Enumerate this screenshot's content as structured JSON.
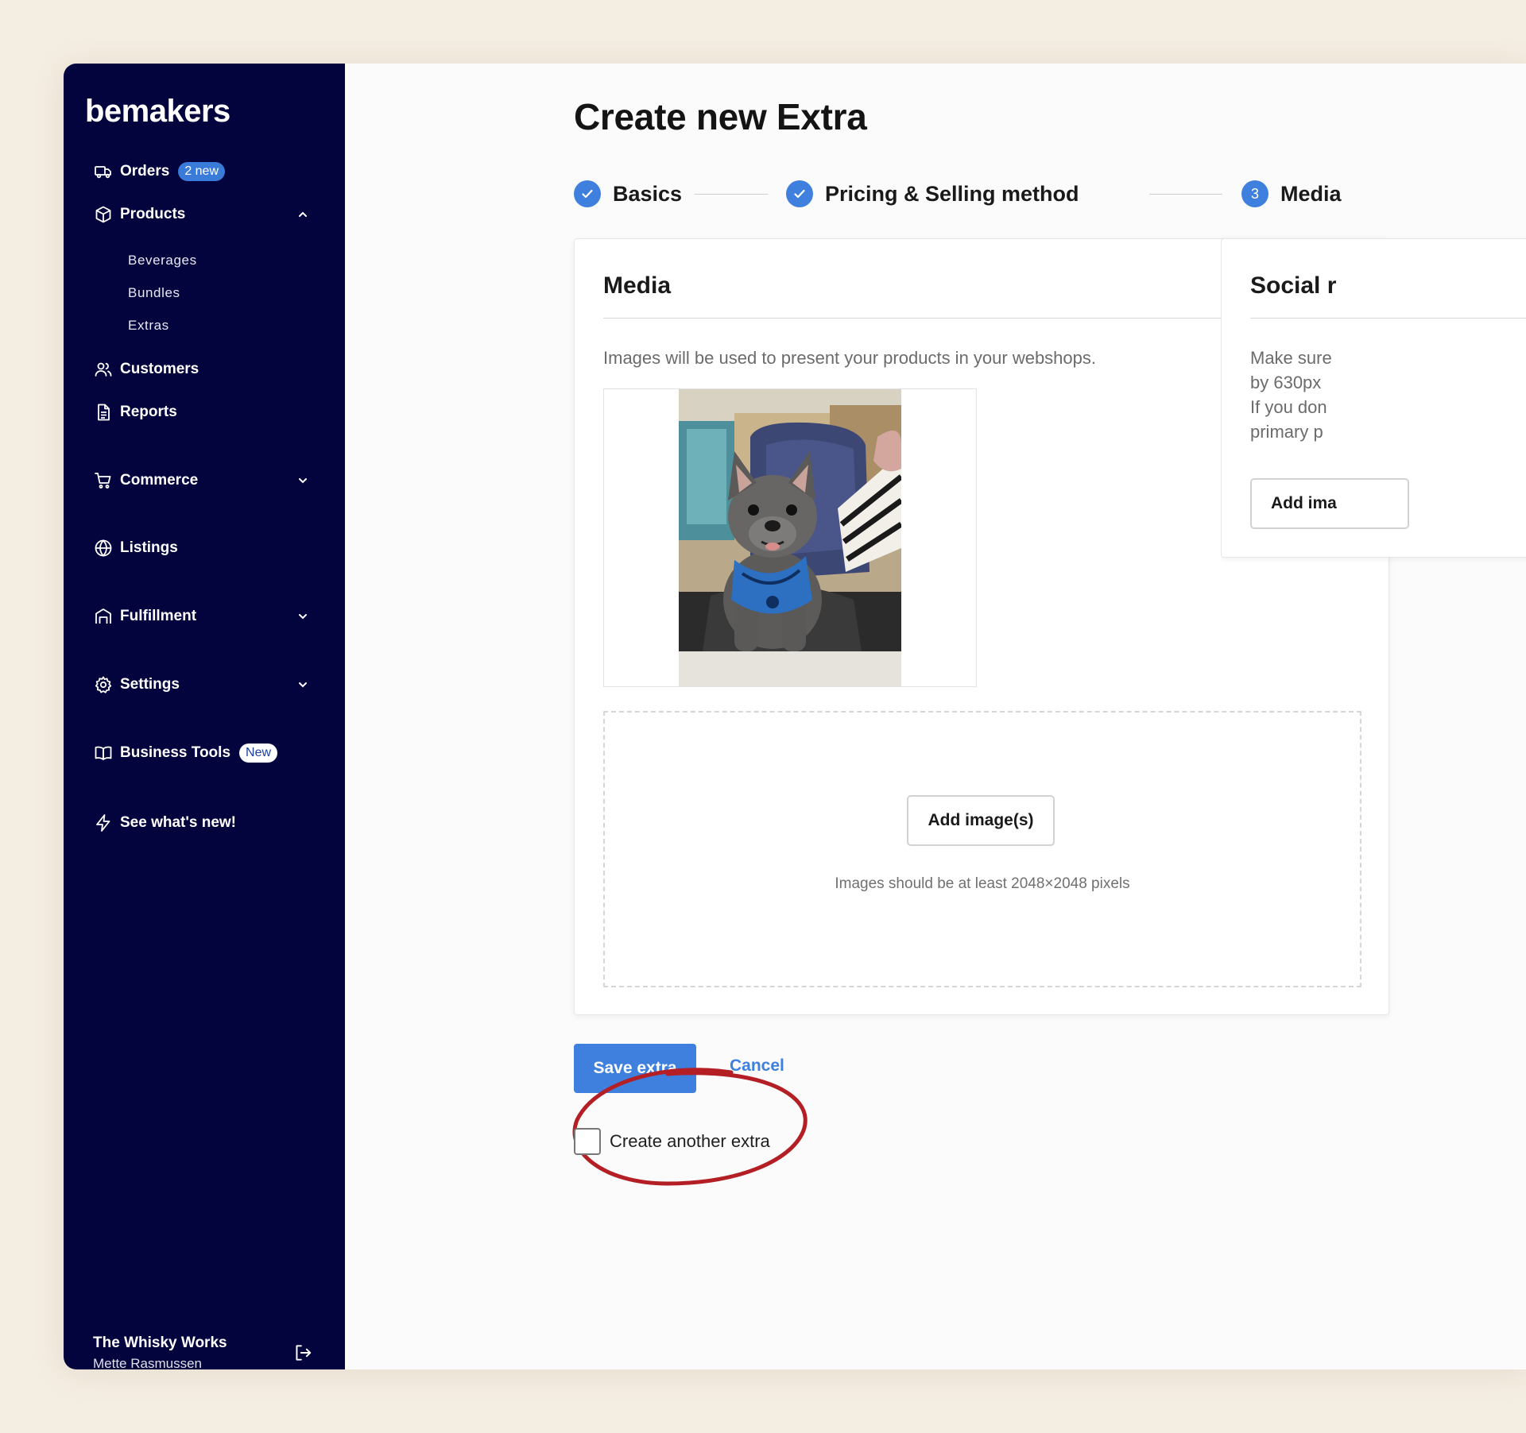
{
  "sidebar": {
    "logo": "bemakers",
    "orders": {
      "label": "Orders",
      "badge": "2 new"
    },
    "products": {
      "label": "Products",
      "subitems": [
        "Beverages",
        "Bundles",
        "Extras"
      ]
    },
    "customers": "Customers",
    "reports": "Reports",
    "commerce": "Commerce",
    "listings": "Listings",
    "fulfillment": "Fulfillment",
    "settings": "Settings",
    "business_tools": {
      "label": "Business Tools",
      "badge": "New"
    },
    "whats_new": "See what's new!",
    "footer": {
      "company": "The Whisky Works",
      "user": "Mette Rasmussen"
    }
  },
  "page": {
    "title": "Create new Extra",
    "steps": [
      {
        "label": "Basics",
        "state": "done"
      },
      {
        "label": "Pricing & Selling method",
        "state": "done"
      },
      {
        "label": "Media",
        "state": "current",
        "number": "3"
      }
    ]
  },
  "media_card": {
    "title": "Media",
    "description": "Images will be used to present your products in your webshops.",
    "add_button": "Add image(s)",
    "hint": "Images should be at least 2048×2048 pixels"
  },
  "social_card": {
    "title": "Social r",
    "lines": [
      "Make sure",
      "by 630px",
      "If you don",
      "primary p"
    ],
    "add_button": "Add ima"
  },
  "actions": {
    "save": "Save extra",
    "cancel": "Cancel",
    "create_another": "Create another extra"
  },
  "colors": {
    "sidebar_bg": "#03033e",
    "accent": "#3f80de",
    "highlight": "#b31f24",
    "page_bg": "#f4ede1"
  }
}
